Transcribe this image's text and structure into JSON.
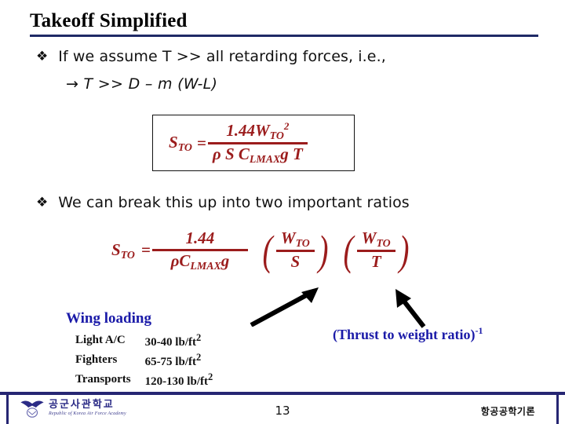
{
  "slide": {
    "title": "Takeoff Simplified",
    "bullet_glyph": "❖",
    "bullets": [
      {
        "text": "If we assume T >> all retarding forces, i.e.,"
      },
      {
        "text": "We can break this up into two important ratios"
      }
    ],
    "sub_line": "→ T >> D – m (W-L)"
  },
  "formula_1": {
    "lhs_symbol": "S",
    "lhs_subscript": "TO",
    "equals": "=",
    "numerator_coefficient": "1.44",
    "numerator_symbol": "W",
    "numerator_subscript": "TO",
    "numerator_exponent": "2",
    "denominator": "ρ S C",
    "denominator_subscript": "LMAX",
    "denominator_tail": "g T",
    "full_text": "S_TO = 1.44 W_TO^2 / (ρ S C_LMAX g T)"
  },
  "formula_2": {
    "lhs_symbol": "S",
    "lhs_subscript": "TO",
    "equals": "=",
    "numerator": "1.44",
    "denominator_rho": "ρ",
    "denominator_symbol": "C",
    "denominator_subscript": "LMAX",
    "denominator_tail": "g",
    "ratio_1": {
      "num_symbol": "W",
      "num_subscript": "TO",
      "den": "S"
    },
    "ratio_2": {
      "num_symbol": "W",
      "num_subscript": "TO",
      "den": "T"
    },
    "full_text": "S_TO = 1.44 / (ρ C_LMAX g) × (W_TO/S) × (W_TO/T)"
  },
  "wing_loading": {
    "heading": "Wing loading",
    "rows": [
      {
        "category": "Light A/C",
        "value": "30-40 lb/ft",
        "exponent": "2"
      },
      {
        "category": "Fighters",
        "value": "65-75 lb/ft",
        "exponent": "2"
      },
      {
        "category": "Transports",
        "value": "120-130 lb/ft",
        "exponent": "2"
      }
    ]
  },
  "thrust_to_weight": {
    "label": "(Thrust to weight ratio)",
    "exponent": "-1"
  },
  "footer": {
    "logo_korean": "공군사관학교",
    "logo_english": "Republic of Korea Air Force Academy",
    "page_number": "13",
    "course_title": "항공공학기론"
  },
  "colors": {
    "title_rule": "#1F2A66",
    "math_red": "#9B1C1C",
    "heading_blue": "#1A1AA8",
    "footer_navy": "#262673"
  }
}
